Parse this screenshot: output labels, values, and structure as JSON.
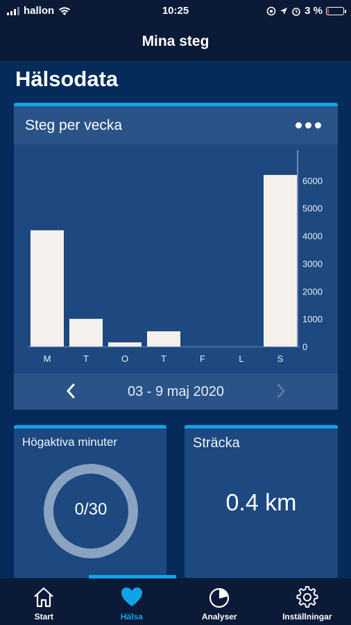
{
  "status": {
    "carrier": "hallon",
    "time": "10:25",
    "battery": "3 %",
    "battery_level": 0.03
  },
  "header": {
    "title": "Mina steg"
  },
  "page": {
    "title": "Hälsodata"
  },
  "chart_card": {
    "title": "Steg per vecka",
    "date_range": "03 - 9 maj 2020",
    "prev_icon": "chevron-left-icon",
    "next_icon": "chevron-right-icon"
  },
  "chart_data": {
    "type": "bar",
    "categories": [
      "M",
      "T",
      "O",
      "T",
      "F",
      "L",
      "S"
    ],
    "values": [
      4200,
      1000,
      150,
      550,
      0,
      0,
      6200
    ],
    "ylim": [
      0,
      6800
    ],
    "yticks": [
      "0",
      "1000",
      "2000",
      "3000",
      "4000",
      "5000",
      "6000"
    ],
    "bar_color": "#f4f1ec",
    "grid": false
  },
  "active_minutes": {
    "title": "Högaktiva minuter",
    "value": "0/30",
    "progress": 0.0
  },
  "distance": {
    "title": "Sträcka",
    "value": "0.4 km"
  },
  "tabs": [
    {
      "label": "Start",
      "icon": "home-icon",
      "active": false
    },
    {
      "label": "Hälsa",
      "icon": "heart-icon",
      "active": true
    },
    {
      "label": "Analyser",
      "icon": "pie-chart-icon",
      "active": false
    },
    {
      "label": "Inställningar",
      "icon": "gear-icon",
      "active": false
    }
  ],
  "colors": {
    "accent": "#11a3e8",
    "background": "#052b5a",
    "card": "#1d4880",
    "bar": "#f4f1ec"
  }
}
